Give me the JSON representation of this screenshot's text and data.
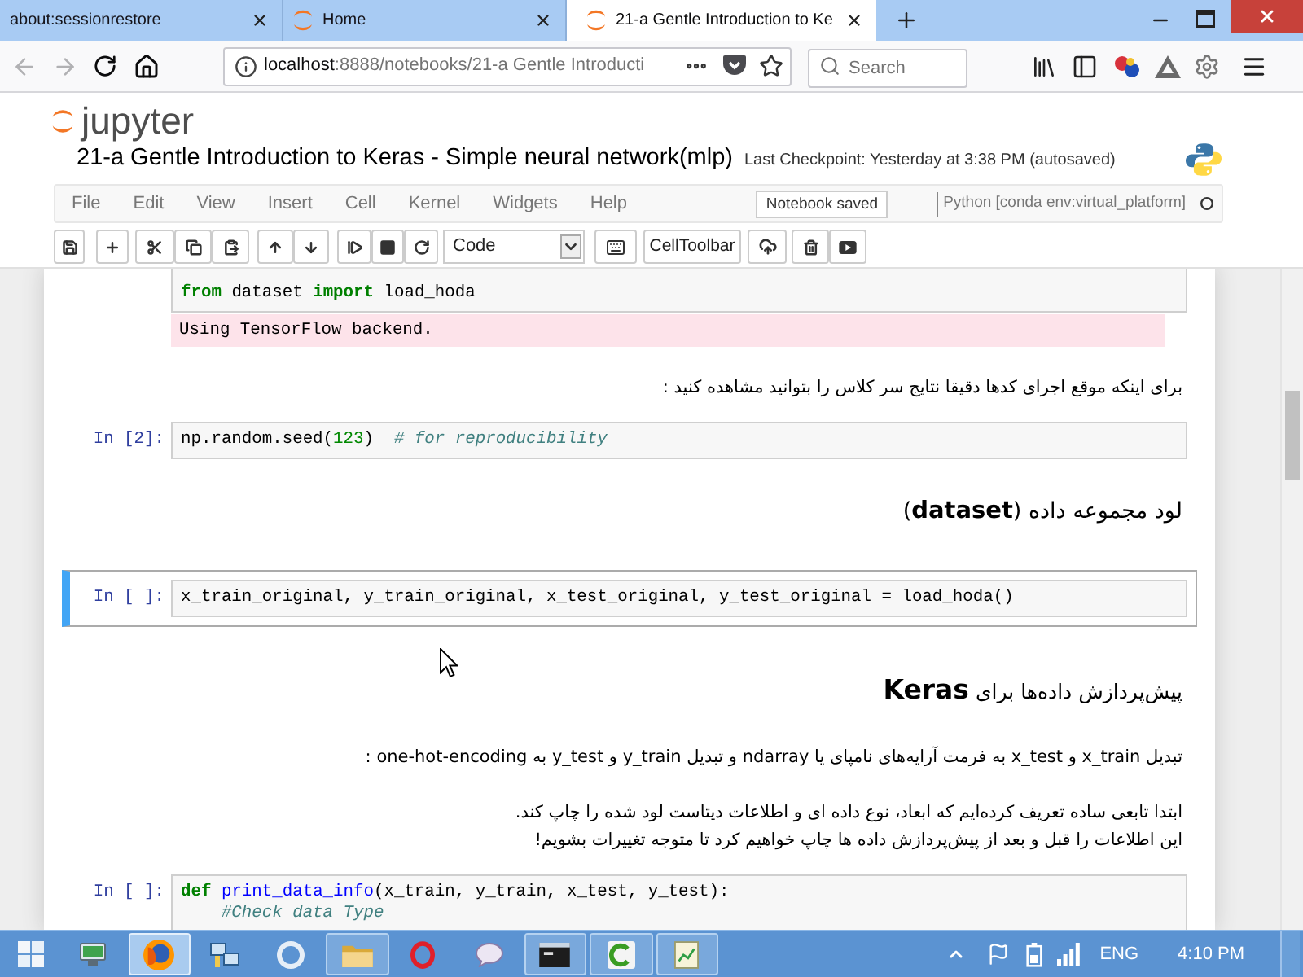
{
  "browser": {
    "tabs": [
      {
        "title": "about:sessionrestore",
        "selected": false,
        "favicon": false
      },
      {
        "title": "Home",
        "selected": false,
        "favicon": true
      },
      {
        "title": "21-a Gentle Introduction to Ke",
        "selected": true,
        "favicon": true
      }
    ],
    "back": {
      "disabled": true
    },
    "forward": {
      "disabled": true
    },
    "url": {
      "host": "localhost",
      "path": ":8888/notebooks/21-a Gentle Introducti"
    },
    "search": {
      "placeholder": "Search"
    }
  },
  "header": {
    "logo": "jupyter",
    "title": "21-a Gentle Introduction to Keras - Simple neural network(mlp)",
    "checkpoint": "Last Checkpoint: Yesterday at 3:38 PM (autosaved)"
  },
  "menu": [
    "File",
    "Edit",
    "View",
    "Insert",
    "Cell",
    "Kernel",
    "Widgets",
    "Help"
  ],
  "notification": "Notebook saved",
  "kernel": {
    "name": "Python [conda env:virtual_platform]",
    "busy": false
  },
  "toolbar": {
    "cell_type": "Code",
    "cell_toolbar": "CellToolbar"
  },
  "cells": [
    {
      "kind": "code",
      "selected": false,
      "lines": [
        [
          {
            "text": "from",
            "kind": "kw"
          },
          {
            "text": " dataset ",
            "kind": "plain"
          },
          {
            "text": "import",
            "kind": "kw"
          },
          {
            "text": " load_hoda",
            "kind": "plain"
          }
        ]
      ],
      "output": {
        "kind": "stderr",
        "text": "Using TensorFlow backend."
      }
    },
    {
      "kind": "markdown",
      "lines": [
        "برای اینکه موقع اجرای کدها دقیقا نتایج سر کلاس را بتوانید مشاهده کنید :"
      ]
    },
    {
      "kind": "code",
      "prompt": "In [2]:",
      "selected": false,
      "lines": [
        [
          {
            "text": "np.random.seed(",
            "kind": "plain"
          },
          {
            "text": "123",
            "kind": "num"
          },
          {
            "text": ")  ",
            "kind": "plain"
          },
          {
            "text": "# for reproducibility",
            "kind": "comment"
          }
        ]
      ]
    },
    {
      "kind": "h3",
      "text": "لود مجموعه داده (**dataset**)"
    },
    {
      "kind": "code",
      "prompt": "In [ ]:",
      "selected": true,
      "lines": [
        [
          {
            "text": "x_train_original, y_train_original, x_test_original, y_test_original = load_hoda()",
            "kind": "plain"
          }
        ]
      ]
    },
    {
      "kind": "h2",
      "text": "پیش‌پردازش داده‌ها برای **Keras**"
    },
    {
      "kind": "markdown",
      "lines": [
        "تبدیل x_train و x_test به فرمت آرایه‌های نامپای یا ndarray و تبدیل y_train و y_test به one-hot-encoding :"
      ]
    },
    {
      "kind": "markdown",
      "lines": [
        "ابتدا تابعی ساده تعریف کرده‌ایم که ابعاد، نوع داده ای و اطلاعات دیتاست لود شده را چاپ کند.",
        "این اطلاعات را قبل و بعد از پیش‌پردازش داده ها چاپ خواهیم کرد تا متوجه تغییرات بشویم!"
      ]
    },
    {
      "kind": "code",
      "prompt": "In [ ]:",
      "selected": false,
      "lines": [
        [
          {
            "text": "def ",
            "kind": "kw"
          },
          {
            "text": "print_data_info",
            "kind": "def"
          },
          {
            "text": "(x_train, y_train, x_test, y_test):",
            "kind": "plain"
          }
        ],
        [
          {
            "text": "    #Check data Type",
            "kind": "comment"
          }
        ]
      ]
    }
  ],
  "taskbar": {
    "apps": [
      {
        "running": false,
        "selected": false
      },
      {
        "running": true,
        "selected": true
      },
      {
        "running": false,
        "selected": false
      },
      {
        "running": false,
        "selected": false
      },
      {
        "running": true,
        "selected": false
      },
      {
        "running": false,
        "selected": false
      },
      {
        "running": false,
        "selected": false
      },
      {
        "running": true,
        "selected": false
      },
      {
        "running": true,
        "selected": false
      },
      {
        "running": true,
        "selected": false
      }
    ],
    "language": "ENG",
    "time": "4:10 PM"
  }
}
